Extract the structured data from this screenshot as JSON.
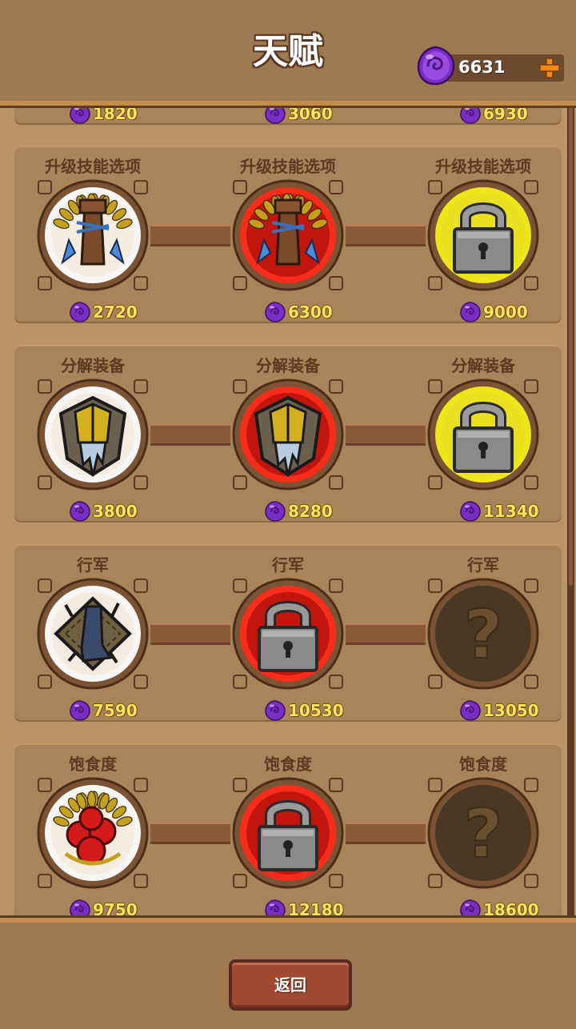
{
  "header": {
    "title": "天赋",
    "currency_value": "6631",
    "currency_icon": "purple-gem-icon",
    "add_icon": "plus-icon"
  },
  "top_partial_costs": [
    "1820",
    "3060",
    "6930"
  ],
  "rows": [
    {
      "nodes": [
        {
          "title": "升级技能选项",
          "cost": "2720",
          "state": "unlocked",
          "icon": "skill-upgrade-icon"
        },
        {
          "title": "升级技能选项",
          "cost": "6300",
          "state": "unlocked-red",
          "icon": "skill-upgrade-icon"
        },
        {
          "title": "升级技能选项",
          "cost": "9000",
          "state": "locked-yellow",
          "icon": "padlock-icon"
        }
      ]
    },
    {
      "nodes": [
        {
          "title": "分解装备",
          "cost": "3800",
          "state": "unlocked",
          "icon": "dismantle-gear-icon"
        },
        {
          "title": "分解装备",
          "cost": "8280",
          "state": "unlocked-red",
          "icon": "dismantle-gear-icon"
        },
        {
          "title": "分解装备",
          "cost": "11340",
          "state": "locked-yellow",
          "icon": "padlock-icon"
        }
      ]
    },
    {
      "nodes": [
        {
          "title": "行军",
          "cost": "7590",
          "state": "unlocked",
          "icon": "boot-icon"
        },
        {
          "title": "行军",
          "cost": "10530",
          "state": "locked-red",
          "icon": "padlock-icon"
        },
        {
          "title": "行军",
          "cost": "13050",
          "state": "unknown",
          "icon": "question-mark-icon"
        }
      ]
    },
    {
      "nodes": [
        {
          "title": "饱食度",
          "cost": "9750",
          "state": "unlocked",
          "icon": "apples-icon"
        },
        {
          "title": "饱食度",
          "cost": "12180",
          "state": "locked-red",
          "icon": "padlock-icon"
        },
        {
          "title": "饱食度",
          "cost": "18600",
          "state": "unknown",
          "icon": "question-mark-icon"
        }
      ]
    }
  ],
  "footer": {
    "back_label": "返回"
  },
  "colors": {
    "background": "#b89466",
    "panel": "#a8845a",
    "cost_text": "#ffe45a",
    "title_text": "#5a3a22",
    "gem": "#8a3ad0",
    "glow_white": "#ffffff",
    "glow_red": "#ff2a1a",
    "glow_yellow": "#f4ee1a"
  }
}
